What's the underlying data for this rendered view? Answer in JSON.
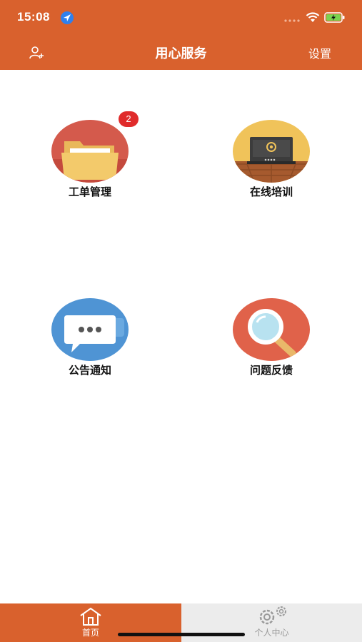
{
  "status": {
    "time": "15:08"
  },
  "nav": {
    "title": "用心服务",
    "settings_label": "设置"
  },
  "tiles": [
    {
      "label": "工单管理",
      "badge": "2"
    },
    {
      "label": "在线培训"
    },
    {
      "label": "公告通知"
    },
    {
      "label": "问题反馈"
    }
  ],
  "tabs": {
    "home_label": "首页",
    "profile_label": "个人中心"
  },
  "colors": {
    "accent": "#d9612d",
    "badge": "#e02b2b",
    "tab_inactive_bg": "#ececec"
  }
}
